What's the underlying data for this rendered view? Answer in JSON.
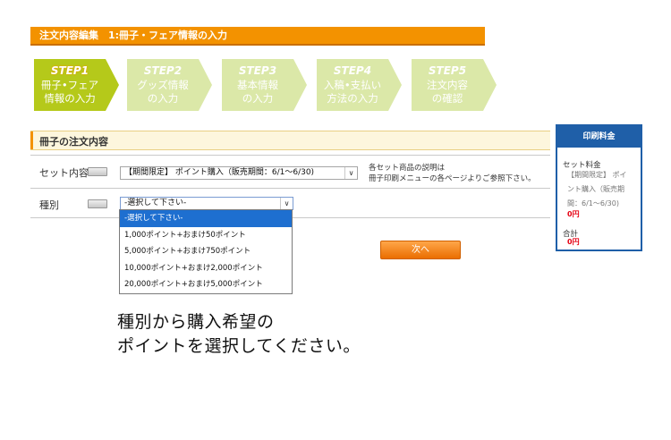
{
  "header": {
    "title": "注文内容編集　1:冊子・フェア情報の入力"
  },
  "steps": [
    {
      "badge": "STEP1",
      "line1": "冊子•フェア",
      "line2": "情報の入力",
      "state": "active"
    },
    {
      "badge": "STEP2",
      "line1": "グッズ情報",
      "line2": "の入力",
      "state": "inactive"
    },
    {
      "badge": "STEP3",
      "line1": "基本情報",
      "line2": "の入力",
      "state": "inactive"
    },
    {
      "badge": "STEP4",
      "line1": "入稿•支払い",
      "line2": "方法の入力",
      "state": "inactive"
    },
    {
      "badge": "STEP5",
      "line1": "注文内容",
      "line2": "の確認",
      "state": "inactive"
    }
  ],
  "colors": {
    "active_step": "#b5c91a",
    "inactive_step": "#dbe8a8",
    "accent": "#f39200",
    "sidebar": "#1f5fa8",
    "price": "#e60012",
    "selected_option": "#1e6fd0"
  },
  "section": {
    "title": "冊子の注文内容"
  },
  "form": {
    "set_label": "セット内容",
    "set_value": "【期間限定】 ポイント購入（販売期間：6/1～6/30)",
    "hint_line1": "各セット商品の説明は",
    "hint_line2": "冊子印刷メニューの各ページよりご参照下さい。",
    "type_label": "種別",
    "type_value": "-選択して下さい-",
    "dropdown_arrow": "∨",
    "type_options": [
      "-選択して下さい-",
      "1,000ポイント+おまけ50ポイント",
      "5,000ポイント+おまけ750ポイント",
      "10,000ポイント+おまけ2,000ポイント",
      "20,000ポイント+おまけ5,000ポイント"
    ]
  },
  "next_button": "次へ",
  "sidebar": {
    "title": "印刷料金",
    "set_price_label": "セット料金",
    "product_line1": "【期間限定】 ポイ",
    "product_line2": "ント購入（販売期",
    "product_line3": "間：6/1～6/30)",
    "set_price": "0円",
    "total_label": "合計",
    "total_price": "0円"
  },
  "caption": {
    "line1": "種別から購入希望の",
    "line2": "ポイントを選択してください。"
  }
}
